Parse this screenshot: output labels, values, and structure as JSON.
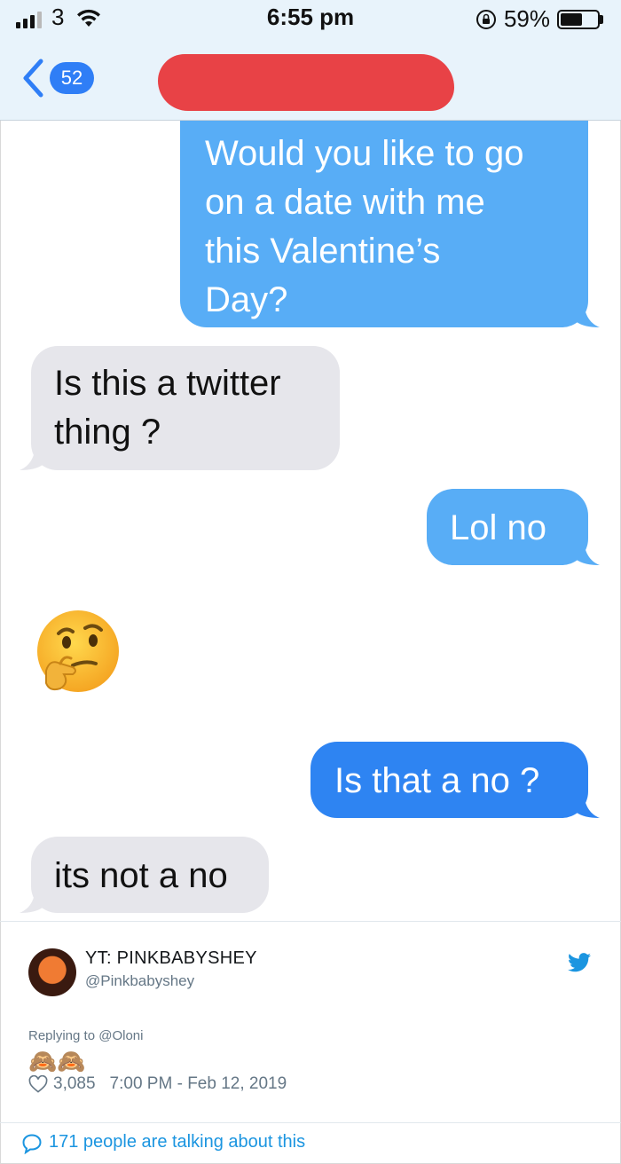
{
  "status_bar": {
    "carrier": "3",
    "time": "6:55 pm",
    "battery": "59%",
    "battery_level": 0.59
  },
  "nav": {
    "back_badge": "52"
  },
  "messages": [
    {
      "from": "me",
      "text": "Would you like to go on a date with me this Valentine’s Day?",
      "lines": [
        "Would you like to go",
        "on a date with me",
        "this Valentine’s",
        "Day?"
      ]
    },
    {
      "from": "them",
      "text": "Is this a twitter thing ?",
      "lines": [
        "Is this a twitter",
        "thing ?"
      ]
    },
    {
      "from": "me",
      "text": "Lol no",
      "lines": [
        "Lol no"
      ]
    },
    {
      "from": "them",
      "text": "🤔",
      "lines": [
        "🤔"
      ]
    },
    {
      "from": "me",
      "text": "Is that a no ?",
      "lines": [
        "Is that a no ?"
      ]
    },
    {
      "from": "them",
      "text": "its not a no",
      "lines": [
        "its not a no"
      ]
    }
  ],
  "tweet": {
    "name": "YT: PINKBABYSHEY",
    "handle": "@Pinkbabyshey",
    "replying_to": "Replying to @Oloni",
    "text": "🙈🙈",
    "likes": "3,085",
    "timestamp": "7:00 PM - Feb 12, 2019",
    "talking": "171 people are talking about this"
  },
  "colors": {
    "sent": "#58adf6",
    "sent_alt": "#2e84f2",
    "received": "#e6e6eb",
    "twitter_blue": "#1b95e0"
  }
}
